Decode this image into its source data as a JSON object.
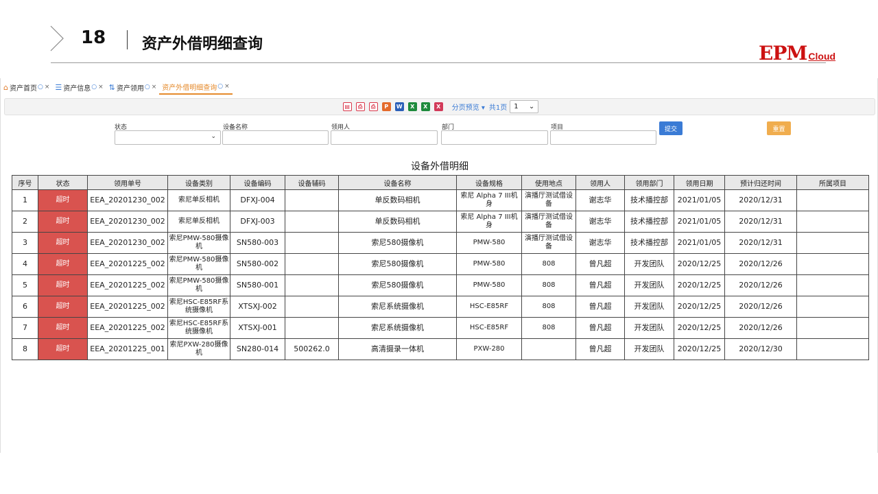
{
  "slide": {
    "number": "18",
    "title": "资产外借明细查询",
    "logo_main": "EPM",
    "logo_sub": "Cloud"
  },
  "tabs": [
    {
      "label": "资产首页",
      "icon": "home-icon",
      "active": false
    },
    {
      "label": "资产信息",
      "icon": "database-icon",
      "active": false
    },
    {
      "label": "资产领用",
      "icon": "transfer-icon",
      "active": false
    },
    {
      "label": "资产外借明细查询",
      "icon": "",
      "active": true
    }
  ],
  "toolbar": {
    "preview_label": "分页预览",
    "page_count": "共1页",
    "page_value": "1"
  },
  "filters": {
    "status_label": "状态",
    "device_name_label": "设备名称",
    "receiver_label": "领用人",
    "department_label": "部门",
    "project_label": "项目",
    "submit_label": "提交",
    "reset_label": "重置"
  },
  "report": {
    "title": "设备外借明细",
    "columns": [
      "序号",
      "状态",
      "领用单号",
      "设备类别",
      "设备编码",
      "设备辅码",
      "设备名称",
      "设备规格",
      "使用地点",
      "领用人",
      "领用部门",
      "领用日期",
      "预计归还时间",
      "所属项目"
    ],
    "rows": [
      [
        "1",
        "超时",
        "EEA_20201230_002",
        "索尼单反相机",
        "DFXJ-004",
        "",
        "单反数码相机",
        "索尼 Alpha 7 III机身",
        "演播厅测试借设备",
        "谢志华",
        "技术播控部",
        "2021/01/05",
        "2020/12/31",
        ""
      ],
      [
        "2",
        "超时",
        "EEA_20201230_002",
        "索尼单反相机",
        "DFXJ-003",
        "",
        "单反数码相机",
        "索尼 Alpha 7 III机身",
        "演播厅测试借设备",
        "谢志华",
        "技术播控部",
        "2021/01/05",
        "2020/12/31",
        ""
      ],
      [
        "3",
        "超时",
        "EEA_20201230_002",
        "索尼PMW-580摄像机",
        "SN580-003",
        "",
        "索尼580摄像机",
        "PMW-580",
        "演播厅测试借设备",
        "谢志华",
        "技术播控部",
        "2021/01/05",
        "2020/12/31",
        ""
      ],
      [
        "4",
        "超时",
        "EEA_20201225_002",
        "索尼PMW-580摄像机",
        "SN580-002",
        "",
        "索尼580摄像机",
        "PMW-580",
        "808",
        "曾凡超",
        "开发团队",
        "2020/12/25",
        "2020/12/26",
        ""
      ],
      [
        "5",
        "超时",
        "EEA_20201225_002",
        "索尼PMW-580摄像机",
        "SN580-001",
        "",
        "索尼580摄像机",
        "PMW-580",
        "808",
        "曾凡超",
        "开发团队",
        "2020/12/25",
        "2020/12/26",
        ""
      ],
      [
        "6",
        "超时",
        "EEA_20201225_002",
        "索尼HSC-E85RF系统摄像机",
        "XTSXJ-002",
        "",
        "索尼系统摄像机",
        "HSC-E85RF",
        "808",
        "曾凡超",
        "开发团队",
        "2020/12/25",
        "2020/12/26",
        ""
      ],
      [
        "7",
        "超时",
        "EEA_20201225_002",
        "索尼HSC-E85RF系统摄像机",
        "XTSXJ-001",
        "",
        "索尼系统摄像机",
        "HSC-E85RF",
        "808",
        "曾凡超",
        "开发团队",
        "2020/12/25",
        "2020/12/26",
        ""
      ],
      [
        "8",
        "超时",
        "EEA_20201225_001",
        "索尼PXW-280摄像机",
        "SN280-014",
        "500262.0",
        "高清摄录一体机",
        "PXW-280",
        "",
        "曾凡超",
        "开发团队",
        "2020/12/25",
        "2020/12/30",
        ""
      ]
    ]
  },
  "colors": {
    "overdue": "#d9534f",
    "active_tab": "#e58a2b",
    "submit": "#3a7bd5",
    "reset": "#f0ad4e",
    "logo": "#cc1111"
  }
}
